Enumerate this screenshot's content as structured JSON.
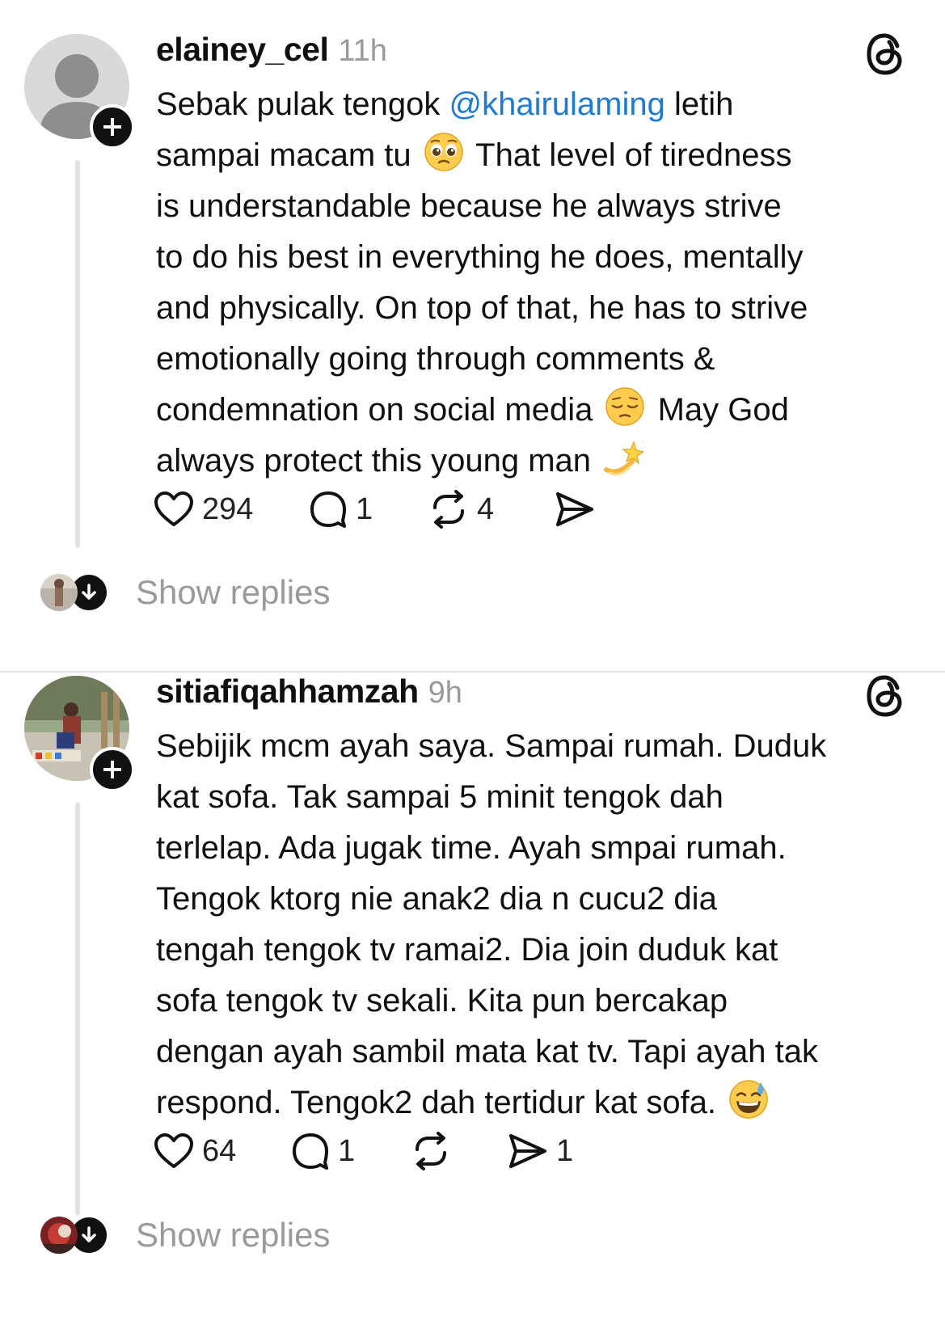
{
  "posts": [
    {
      "username": "elainey_cel",
      "time": "11h",
      "avatar": "default-avatar",
      "body_lines": [
        {
          "segments": [
            {
              "text": "Sebak pulak tengok "
            },
            {
              "text": "@khairulaming",
              "mention": true
            },
            {
              "text": " letih"
            }
          ]
        },
        {
          "segments": [
            {
              "text": "sampai macam tu "
            },
            {
              "emoji": "pleading-face-emoji"
            },
            {
              "text": " That level of tiredness"
            }
          ]
        },
        {
          "segments": [
            {
              "text": "is understandable because he always strive"
            }
          ]
        },
        {
          "segments": [
            {
              "text": "to do his best in everything he does, mentally"
            }
          ]
        },
        {
          "segments": [
            {
              "text": "and physically. On top of that, he has to strive"
            }
          ]
        },
        {
          "segments": [
            {
              "text": "emotionally going through comments &"
            }
          ]
        },
        {
          "segments": [
            {
              "text": "condemnation on social media "
            },
            {
              "emoji": "pensive-face-emoji"
            },
            {
              "text": " May God"
            }
          ]
        },
        {
          "segments": [
            {
              "text": "always protect this young man "
            },
            {
              "emoji": "dizzy-emoji"
            }
          ]
        }
      ],
      "actions": {
        "likes": "294",
        "replies": "1",
        "reposts": "4",
        "shares": ""
      },
      "show_replies": "Show replies"
    },
    {
      "username": "sitiafiqahhamzah",
      "time": "9h",
      "avatar": "photo-avatar",
      "body_lines": [
        {
          "segments": [
            {
              "text": "Sebijik mcm ayah saya. Sampai rumah. Duduk"
            }
          ]
        },
        {
          "segments": [
            {
              "text": "kat sofa. Tak sampai 5 minit tengok dah"
            }
          ]
        },
        {
          "segments": [
            {
              "text": "terlelap. Ada jugak time. Ayah smpai rumah."
            }
          ]
        },
        {
          "segments": [
            {
              "text": "Tengok ktorg nie anak2 dia n cucu2 dia"
            }
          ]
        },
        {
          "segments": [
            {
              "text": "tengah tengok tv ramai2. Dia join duduk kat"
            }
          ]
        },
        {
          "segments": [
            {
              "text": "sofa tengok tv sekali. Kita pun bercakap"
            }
          ]
        },
        {
          "segments": [
            {
              "text": "dengan ayah sambil mata kat tv. Tapi ayah tak"
            }
          ]
        },
        {
          "segments": [
            {
              "text": "respond. Tengok2 dah tertidur kat sofa. "
            },
            {
              "emoji": "grinning-sweat-emoji"
            }
          ]
        }
      ],
      "actions": {
        "likes": "64",
        "replies": "1",
        "reposts": "",
        "shares": "1"
      },
      "show_replies": "Show replies"
    }
  ],
  "colors": {
    "mention": "#1d7bd8",
    "muted": "#9a9a9a",
    "text": "#101010"
  }
}
